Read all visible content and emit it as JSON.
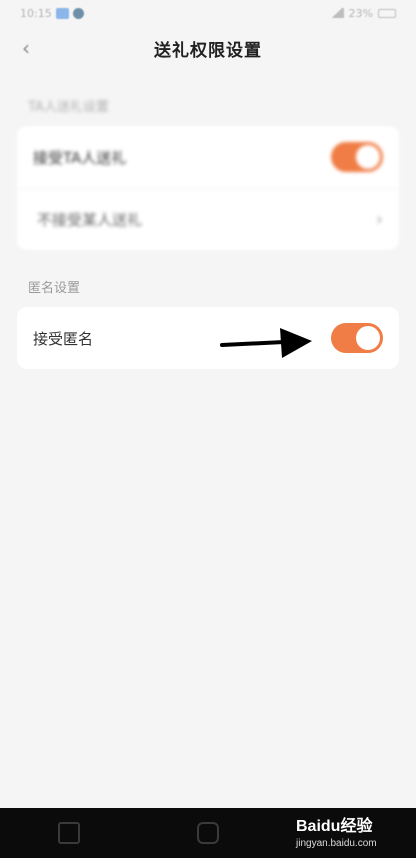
{
  "status_bar": {
    "time": "10:15",
    "battery": "23%"
  },
  "header": {
    "back_glyph": "‹",
    "title": "送礼权限设置"
  },
  "sections": [
    {
      "label": "TA人送礼设置",
      "rows": [
        {
          "label": "接受TA人送礼",
          "control": "toggle",
          "on": true
        },
        {
          "label": "不接受某人送礼",
          "control": "chevron",
          "chevron_glyph": "›"
        }
      ]
    },
    {
      "label": "匿名设置",
      "rows": [
        {
          "label": "接受匿名",
          "control": "toggle",
          "on": true
        }
      ]
    }
  ],
  "colors": {
    "accent": "#f07d45",
    "background": "#f5f5f5",
    "card": "#ffffff"
  },
  "watermark": {
    "brand": "Baidu经验",
    "url": "jingyan.baidu.com"
  }
}
